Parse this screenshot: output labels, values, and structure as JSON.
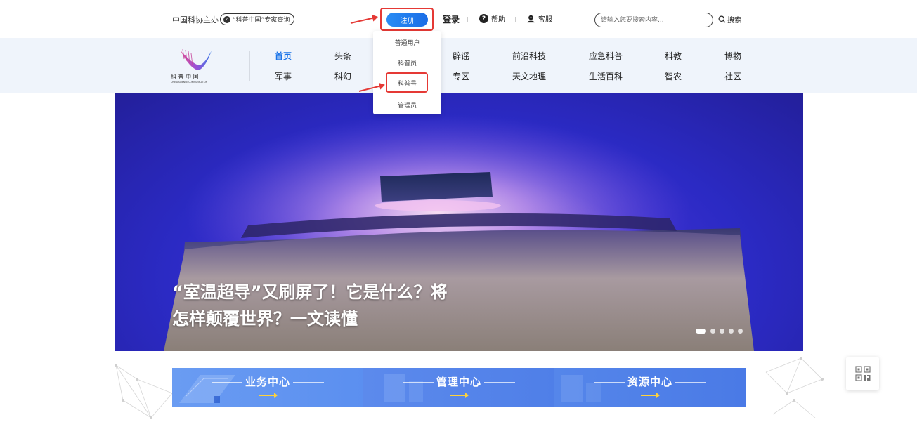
{
  "topbar": {
    "sponsor": "中国科协主办",
    "expert_query": "“科普中国”专家查询",
    "register_label": "注册",
    "login_label": "登录",
    "help_label": "帮助",
    "service_label": "客服",
    "search_placeholder": "请输入您要搜索内容...",
    "search_label": "搜索"
  },
  "logo": {
    "icon": "kepu-china-logo",
    "chars": "科 普 中 国",
    "sub": "CHINA SCIENCE COMMUNICATION"
  },
  "nav": {
    "row1": [
      "首页",
      "头条",
      "辟谣",
      "前沿科技",
      "应急科普",
      "科教",
      "博物"
    ],
    "row2": [
      "军事",
      "科幻",
      "专区",
      "天文地理",
      "生活百科",
      "智农",
      "社区"
    ]
  },
  "register_dropdown": {
    "items": [
      "普通用户",
      "科普员",
      "科普号",
      "管理员"
    ],
    "highlighted": "科普号"
  },
  "banner": {
    "title_line1": "“室温超导”又刷屏了！它是什么？将",
    "title_line2": "怎样颠覆世界？一文读懂",
    "slide_count": 5,
    "active_slide": 1
  },
  "centers": [
    {
      "label": "业务中心",
      "color": "#5b8ff0"
    },
    {
      "label": "管理中心",
      "color": "#4f7fe8"
    },
    {
      "label": "资源中心",
      "color": "#4a7ae6"
    }
  ],
  "floating": {
    "icon": "qr-code-icon"
  },
  "colors": {
    "accent": "#1a73e8",
    "annotation_red": "#e53935",
    "nav_band": "#eff4fb"
  }
}
